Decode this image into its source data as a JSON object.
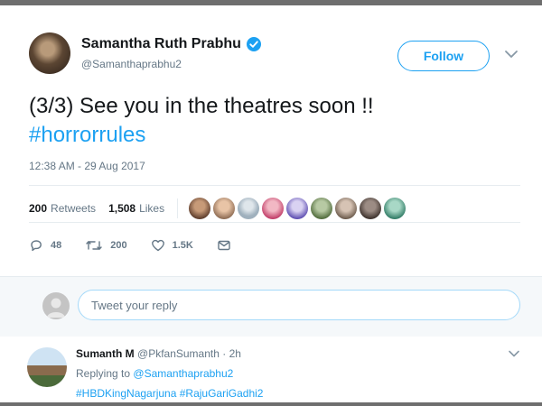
{
  "tweet": {
    "author_name": "Samantha Ruth Prabhu",
    "author_handle": "@Samanthaprabhu2",
    "follow_label": "Follow",
    "text": "(3/3) See you in the theatres soon !!",
    "hashtag": "#horrorrules",
    "timestamp": "12:38 AM - 29 Aug 2017",
    "retweets_count": "200",
    "retweets_label": "Retweets",
    "likes_count": "1,508",
    "likes_label": "Likes",
    "actions": {
      "replies": "48",
      "retweets": "200",
      "likes": "1.5K"
    }
  },
  "reply_box": {
    "placeholder": "Tweet your reply"
  },
  "reply_tweet": {
    "name": "Sumanth M",
    "handle": "@PkfanSumanth",
    "separator": "·",
    "time": "2h",
    "replying_prefix": "Replying to",
    "replying_handle": "@Samanthaprabhu2",
    "hashtags": "#HBDKingNagarjuna #RajuGariGadhi2"
  },
  "colors": {
    "accent": "#1da1f2",
    "muted": "#657786",
    "text": "#14171a"
  },
  "icons": [
    "verified-badge-icon",
    "chevron-down-icon",
    "reply-icon",
    "retweet-icon",
    "heart-icon",
    "direct-message-icon"
  ]
}
